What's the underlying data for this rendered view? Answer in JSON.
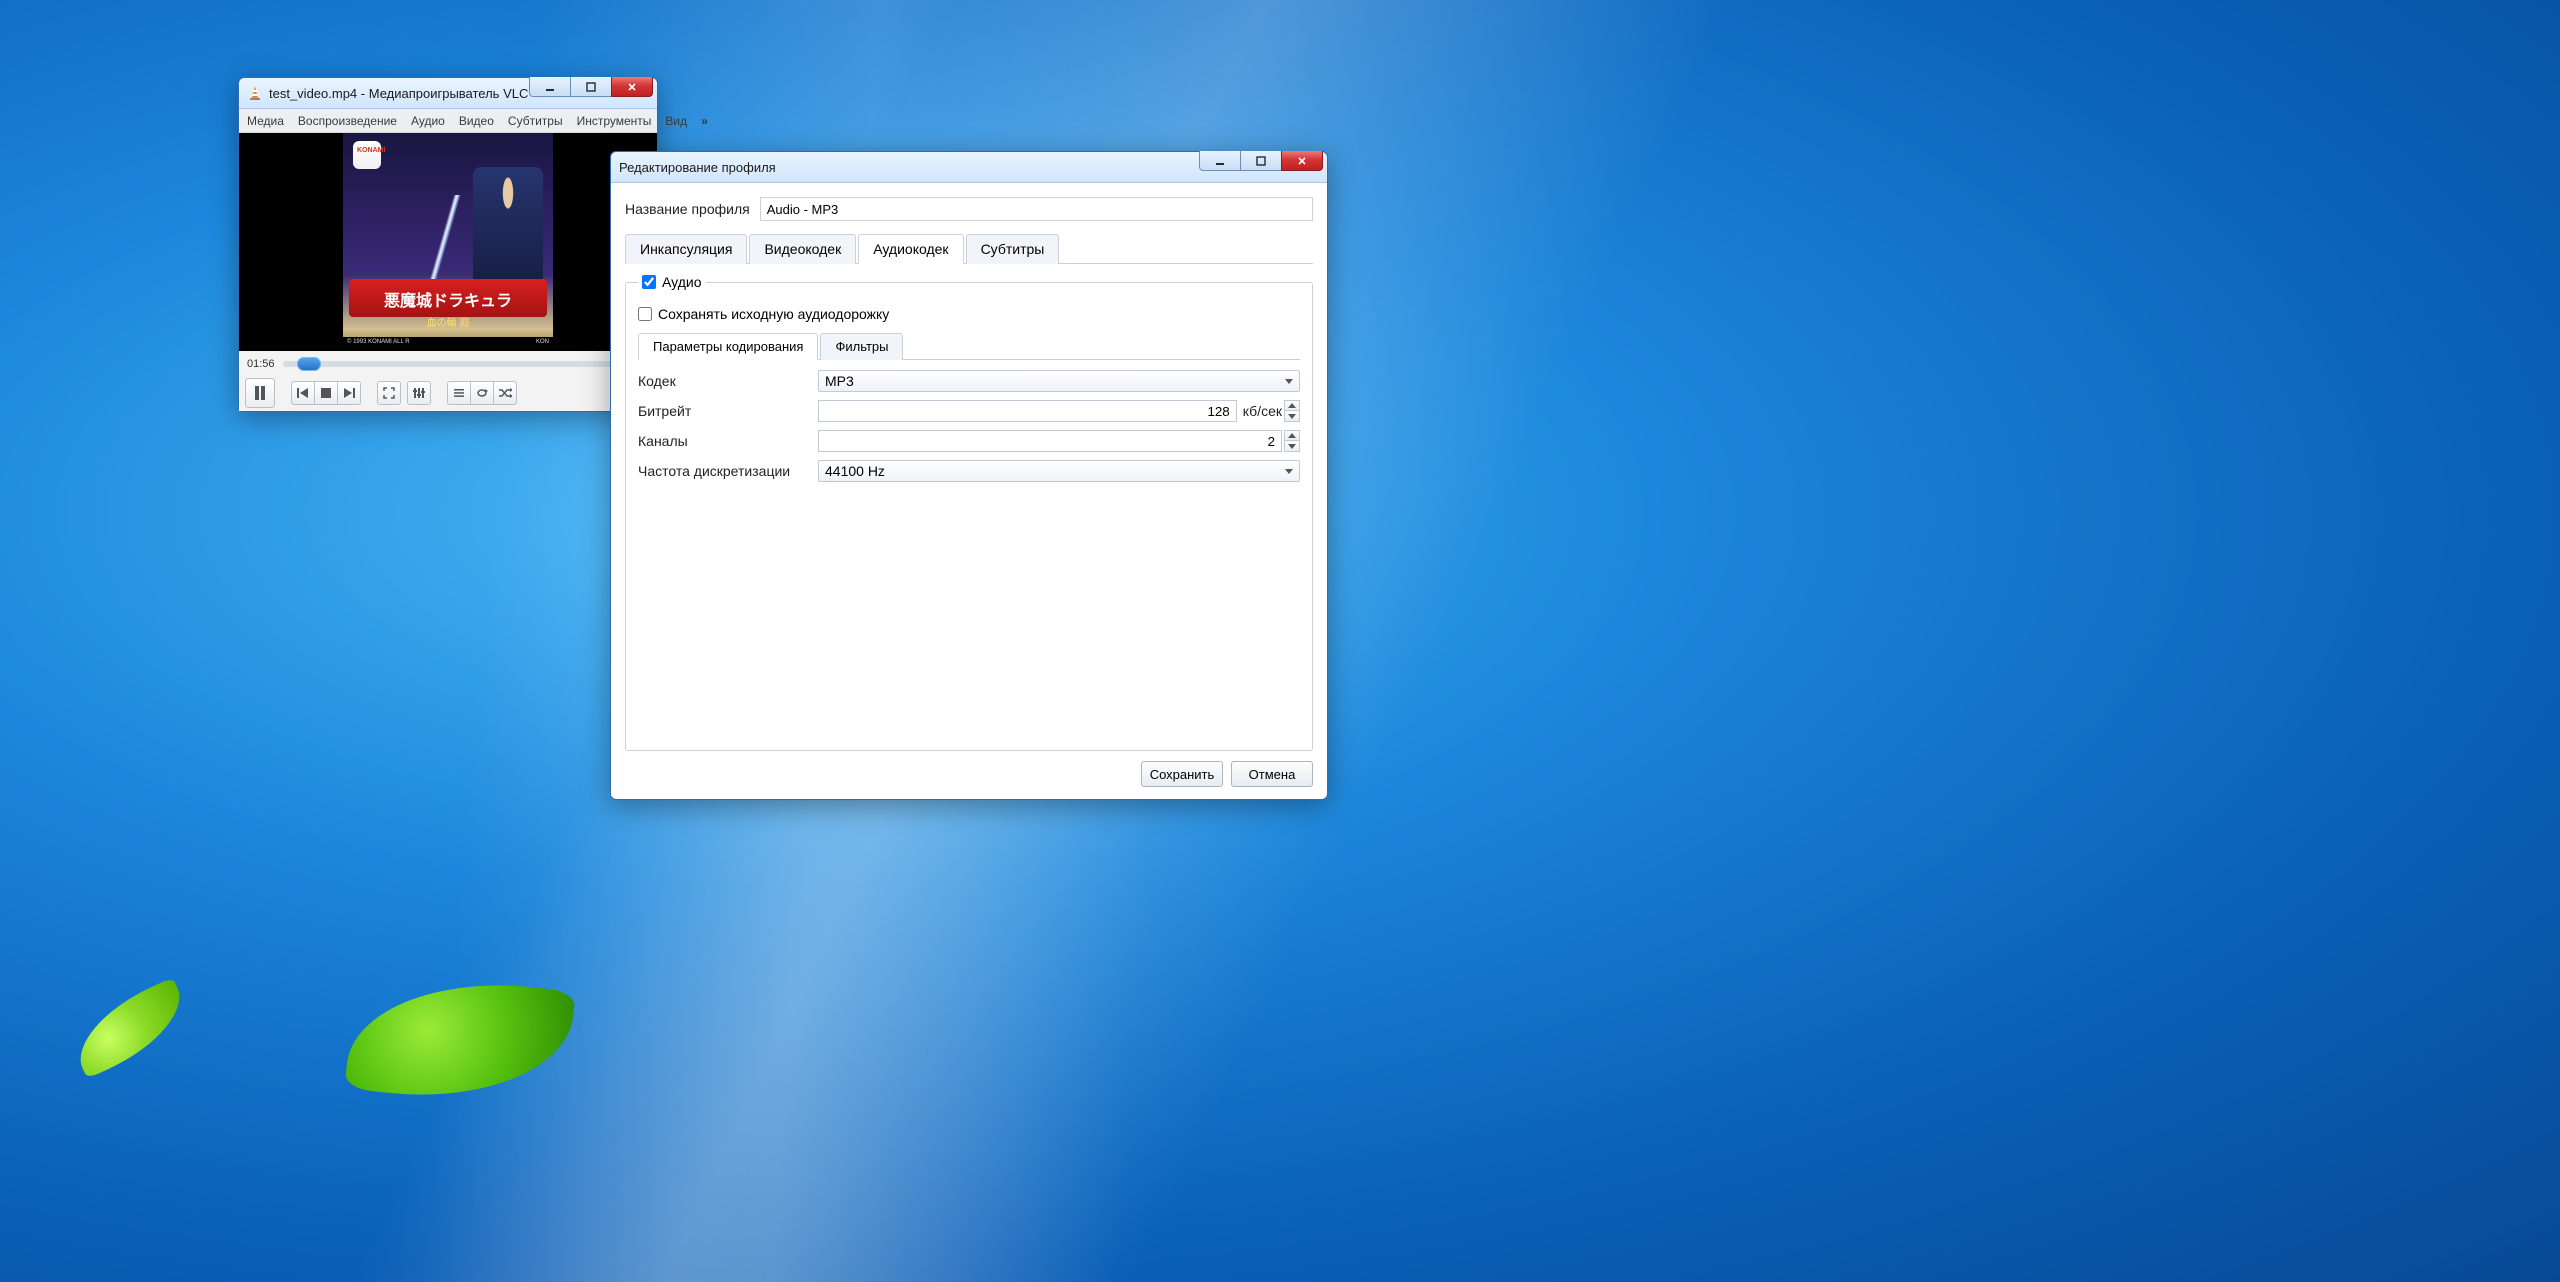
{
  "vlc": {
    "title": "test_video.mp4 - Медиапроигрыватель VLC",
    "menu": [
      "Медиа",
      "Воспроизведение",
      "Аудио",
      "Видео",
      "Субтитры",
      "Инструменты",
      "Вид"
    ],
    "time": "01:56",
    "cover": {
      "konami": "KONAMI",
      "jp1": "悪魔城ドラキュラ",
      "jp2": "血の輪 廻",
      "footer_left": "© 1993 KONAMI  ALL R",
      "footer_right": "KON"
    }
  },
  "dlg": {
    "title": "Редактирование профиля",
    "profile_label": "Название профиля",
    "profile_value": "Audio - MP3",
    "tabs": [
      "Инкапсуляция",
      "Видеокодек",
      "Аудиокодек",
      "Субтитры"
    ],
    "audio_checkbox": "Аудио",
    "keep_track": "Сохранять исходную аудиодорожку",
    "inner_tabs": [
      "Параметры кодирования",
      "Фильтры"
    ],
    "codec_label": "Кодек",
    "codec_value": "MP3",
    "bitrate_label": "Битрейт",
    "bitrate_value": "128",
    "bitrate_unit": "кб/сек",
    "channels_label": "Каналы",
    "channels_value": "2",
    "samplerate_label": "Частота дискретизации",
    "samplerate_value": "44100 Hz",
    "save": "Сохранить",
    "cancel": "Отмена"
  }
}
